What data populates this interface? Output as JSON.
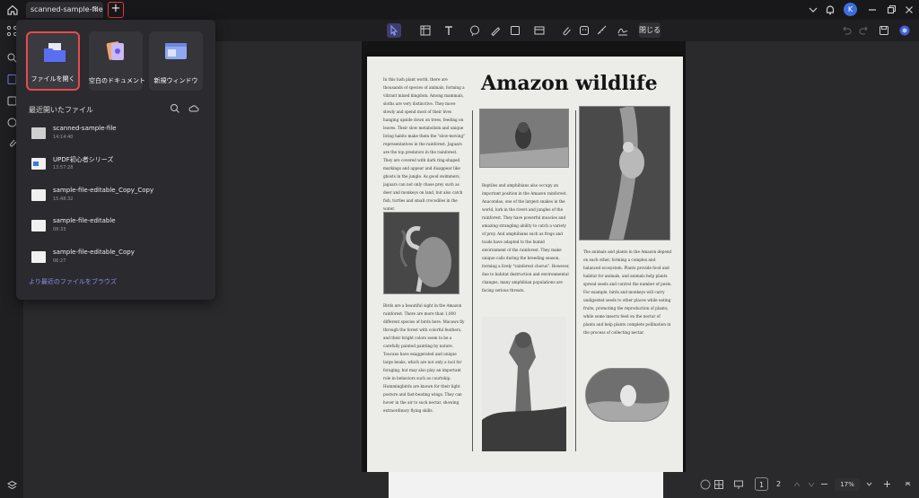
{
  "titlebar": {
    "tab_label": "scanned-sample-file",
    "tab_close": "×",
    "new_tab": "+",
    "avatar_letter": "K"
  },
  "toolbar": {
    "close_label": "閉じる"
  },
  "popover": {
    "cards": [
      {
        "label": "ファイルを開く"
      },
      {
        "label": "空白のドキュメント"
      },
      {
        "label": "新規ウィンドウ"
      }
    ],
    "recent_heading": "最近開いたファイル",
    "files": [
      {
        "name": "scanned-sample-file",
        "time": "14:14:40"
      },
      {
        "name": "UPDF初心者シリーズ",
        "time": "13:57:28"
      },
      {
        "name": "sample-file-editable_Copy_Copy",
        "time": "15:48:32"
      },
      {
        "name": "sample-file-editable",
        "time": "08:33"
      },
      {
        "name": "sample-file-editable_Copy",
        "time": "06:27"
      }
    ],
    "browse_label": "より最近のファイルをブラウズ"
  },
  "document": {
    "title": "Amazon wildlife",
    "col1_top": "In this lush plant world, there are thousands of species of animals, forming a vibrant mixed kingdom. Among mammals, sloths are very distinctive. They move slowly and spend most of their lives hanging upside down on trees, feeding on leaves. Their slow metabolism and unique living habits make them the \"slow-moving\" representatives in the rainforest. Jaguars are the top predators in the rainforest. They are covered with dark ring-shaped markings and appear and disappear like ghosts in the jungle. As good swimmers, jaguars can not only chase prey such as deer and monkeys on land, but also catch fish, turtles and small crocodiles in the water.",
    "col1_bottom": "Birds are a beautiful sight in the Amazon rainforest. There are more than 1,000 different species of birds here. Macaws fly through the forest with colorful feathers, and their bright colors seem to be a carefully painted painting by nature. Toucans have exaggerated and unique large beaks, which are not only a tool for foraging, but may also play an important role in behaviors such as courtship. Hummingbirds are known for their light posture and fast-beating wings. They can hover in the air to suck nectar, showing extraordinary flying skills.",
    "col2_text": "Reptiles and amphibians also occupy an important position in the Amazon rainforest. Anacondas, one of the largest snakes in the world, lurk in the rivers and jungles of the rainforest. They have powerful muscles and amazing strangling ability to catch a variety of prey. And amphibians such as frogs and toads have adapted to the humid environment of the rainforest. They make unique calls during the breeding season, forming a lively \"rainforest chorus\". However, due to habitat destruction and environmental changes, many amphibian populations are facing serious threats.",
    "col3_text": "The animals and plants in the Amazon depend on each other, forming a complex and balanced ecosystem. Plants provide food and habitat for animals, and animals help plants spread seeds and control the number of pests. For example, birds and monkeys will carry undigested seeds to other places while eating fruits, promoting the reproduction of plants; while some insects feed on the nectar of plants and help plants complete pollination in the process of collecting nectar."
  },
  "bottombar": {
    "page_current": "1",
    "page_next": "2",
    "zoom": "17%"
  }
}
